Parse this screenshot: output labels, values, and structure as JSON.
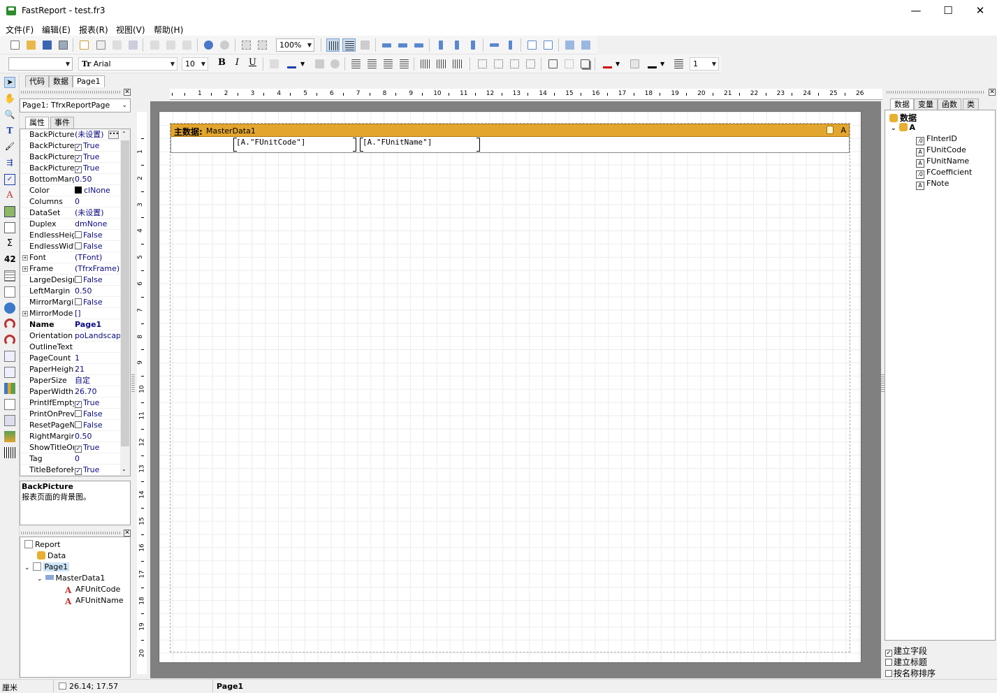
{
  "window": {
    "title": "FastReport - test.fr3"
  },
  "menu": [
    "文件(F)",
    "编辑(E)",
    "报表(R)",
    "视图(V)",
    "帮助(H)"
  ],
  "toolbar": {
    "zoom": "100%",
    "font_name": "Arial",
    "font_size": "10",
    "style_combo": "",
    "bold": "B",
    "italic": "I",
    "underline": "U",
    "frame_width": "1"
  },
  "tabs": [
    "代码",
    "数据",
    "Page1"
  ],
  "inspector": {
    "object_combo": "Page1: TfrxReportPage",
    "tabs": [
      "属性",
      "事件"
    ],
    "properties": [
      {
        "name": "BackPicture",
        "value": "(未设置)",
        "kind": "dots"
      },
      {
        "name": "BackPicturePr",
        "value": "True",
        "kind": "check",
        "checked": true
      },
      {
        "name": "BackPictureSt",
        "value": "True",
        "kind": "check",
        "checked": true
      },
      {
        "name": "BackPictureVi",
        "value": "True",
        "kind": "check",
        "checked": true
      },
      {
        "name": "BottomMargin",
        "value": "0.50"
      },
      {
        "name": "Color",
        "value": "clNone",
        "kind": "color"
      },
      {
        "name": "Columns",
        "value": "0"
      },
      {
        "name": "DataSet",
        "value": "(未设置)"
      },
      {
        "name": "Duplex",
        "value": "dmNone"
      },
      {
        "name": "EndlessHeigh",
        "value": "False",
        "kind": "check",
        "checked": false
      },
      {
        "name": "EndlessWidth",
        "value": "False",
        "kind": "check",
        "checked": false
      },
      {
        "name": "Font",
        "value": "(TFont)",
        "kind": "expand"
      },
      {
        "name": "Frame",
        "value": "(TfrxFrame)",
        "kind": "expand"
      },
      {
        "name": "LargeDesignH",
        "value": "False",
        "kind": "check",
        "checked": false
      },
      {
        "name": "LeftMargin",
        "value": "0.50"
      },
      {
        "name": "MirrorMargins",
        "value": "False",
        "kind": "check",
        "checked": false
      },
      {
        "name": "MirrorMode",
        "value": "[]",
        "kind": "expand"
      },
      {
        "name": "Name",
        "value": "Page1",
        "kind": "bold"
      },
      {
        "name": "Orientation",
        "value": "poLandscape"
      },
      {
        "name": "OutlineText",
        "value": ""
      },
      {
        "name": "PageCount",
        "value": "1"
      },
      {
        "name": "PaperHeight",
        "value": "21"
      },
      {
        "name": "PaperSize",
        "value": "自定"
      },
      {
        "name": "PaperWidth",
        "value": "26.70"
      },
      {
        "name": "PrintIfEmpty",
        "value": "True",
        "kind": "check",
        "checked": true
      },
      {
        "name": "PrintOnPrevio",
        "value": "False",
        "kind": "check",
        "checked": false
      },
      {
        "name": "ResetPageNu",
        "value": "False",
        "kind": "check",
        "checked": false
      },
      {
        "name": "RightMargin",
        "value": "0.50"
      },
      {
        "name": "ShowTitleOnP",
        "value": "True",
        "kind": "check",
        "checked": true
      },
      {
        "name": "Tag",
        "value": "0"
      },
      {
        "name": "TitleBeforeHe",
        "value": "True",
        "kind": "check",
        "checked": true
      }
    ],
    "desc_title": "BackPicture",
    "desc_text": "报表页面的背景图。"
  },
  "report_tree": {
    "report": "Report",
    "data": "Data",
    "page": "Page1",
    "band": "MasterData1",
    "memo1": "AFUnitCode",
    "memo2": "AFUnitName"
  },
  "band": {
    "title_cn": "主数据:",
    "title": "MasterData1",
    "right_label": "A"
  },
  "memos": [
    "[A.\"FUnitCode\"]",
    "[A.\"FUnitName\"]"
  ],
  "hruler": [
    "1",
    "2",
    "3",
    "4",
    "5",
    "6",
    "7",
    "8",
    "9",
    "10",
    "11",
    "12",
    "13",
    "14",
    "15",
    "16",
    "17",
    "18",
    "19",
    "20",
    "21",
    "22",
    "23",
    "24",
    "25",
    "26"
  ],
  "vruler": [
    "1",
    "2",
    "3",
    "4",
    "5",
    "6",
    "7",
    "8",
    "9",
    "10",
    "11",
    "12",
    "13",
    "14",
    "15",
    "16",
    "17",
    "18",
    "19",
    "20"
  ],
  "right_tabs": [
    "数据",
    "变量",
    "函数",
    "类"
  ],
  "data_tree": {
    "root": "数据",
    "dataset": "A",
    "fields": [
      "FInterID",
      "FUnitCode",
      "FUnitName",
      "FCoefficient",
      "FNote"
    ]
  },
  "options": [
    {
      "label": "建立字段",
      "checked": true
    },
    {
      "label": "建立标题",
      "checked": false
    },
    {
      "label": "按名称排序",
      "checked": false
    }
  ],
  "status": {
    "units": "厘米",
    "coords": "26.14; 17.57",
    "page": "Page1"
  },
  "colors": {
    "band": "#e2a52e",
    "designer_bg": "#808080"
  }
}
